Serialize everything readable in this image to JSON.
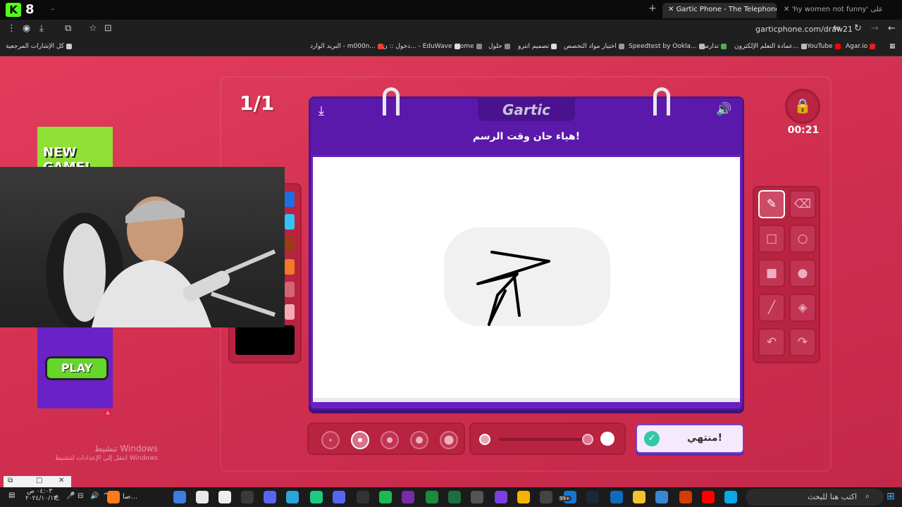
{
  "browser": {
    "kick_number": "8",
    "active_tab_title": "Gartic Phone - The Telephone G",
    "other_tab_title": "'hy women not funny' اعثر على",
    "url": "garticphone.com/draw21"
  },
  "bookmarks": [
    {
      "label": "Agar.io",
      "color": "#e02020"
    },
    {
      "label": "YouTube",
      "color": "#ff0000"
    },
    {
      "label": "عمادة التعلم الإلكترون...",
      "color": "#bbbbbb"
    },
    {
      "label": "تدارس",
      "color": "#4caf50"
    },
    {
      "label": "Speedtest by Ookla...",
      "color": "#bbbbbb"
    },
    {
      "label": "اختيار مواد التخصص",
      "color": "#999999"
    },
    {
      "label": "تصميم انترو",
      "color": "#dddddd"
    },
    {
      "label": "حلول",
      "color": "#888888"
    },
    {
      "label": "Home",
      "color": "#888888"
    },
    {
      "label": "دخول :: ن... - EduWave",
      "color": "#dddddd"
    },
    {
      "label": "البريد الوارد - m000n...",
      "color": "#ea4335"
    },
    {
      "label": "كل الإشارات المرجعية",
      "color": "#cccccc"
    }
  ],
  "game": {
    "round": "1/1",
    "logo": "Gartic",
    "prompt": "هياء حان وقت الرسم!",
    "timer": "00:21",
    "done_label": "منتهي!",
    "selected_tool": "pencil",
    "selected_size_index": 1,
    "tools": [
      {
        "name": "pencil-tool",
        "glyph": "✎"
      },
      {
        "name": "eraser-tool",
        "glyph": "⌫"
      },
      {
        "name": "rectangle-tool",
        "glyph": "□"
      },
      {
        "name": "ellipse-tool",
        "glyph": "○"
      },
      {
        "name": "filled-rectangle-tool",
        "glyph": "■"
      },
      {
        "name": "filled-ellipse-tool",
        "glyph": "●"
      },
      {
        "name": "line-tool",
        "glyph": "╱"
      },
      {
        "name": "fill-bucket-tool",
        "glyph": "◈"
      },
      {
        "name": "undo-tool",
        "glyph": "↶"
      },
      {
        "name": "redo-tool",
        "glyph": "↷"
      }
    ],
    "colors": [
      "#1f6fe0",
      "#33c3f2",
      "#9c3a1a",
      "#f07a2a",
      "#d46470",
      "#f5aab3"
    ],
    "active_color": "#000000"
  },
  "ad": {
    "headline": "NEW GAME!",
    "cta": "PLAY",
    "badge": "A"
  },
  "watermark": {
    "line1": "تنشيط Windows",
    "line2": "انتقل إلى الإعدادات لتنشيط Windows"
  },
  "taskbar": {
    "search_placeholder": "اكتب هنا للبحث",
    "time": "٠٤:٠٣ ص",
    "date": "٢٠٢٤/١٠/١٣",
    "lang": "ع",
    "app_label": "صا...",
    "badge_count": "99+"
  }
}
